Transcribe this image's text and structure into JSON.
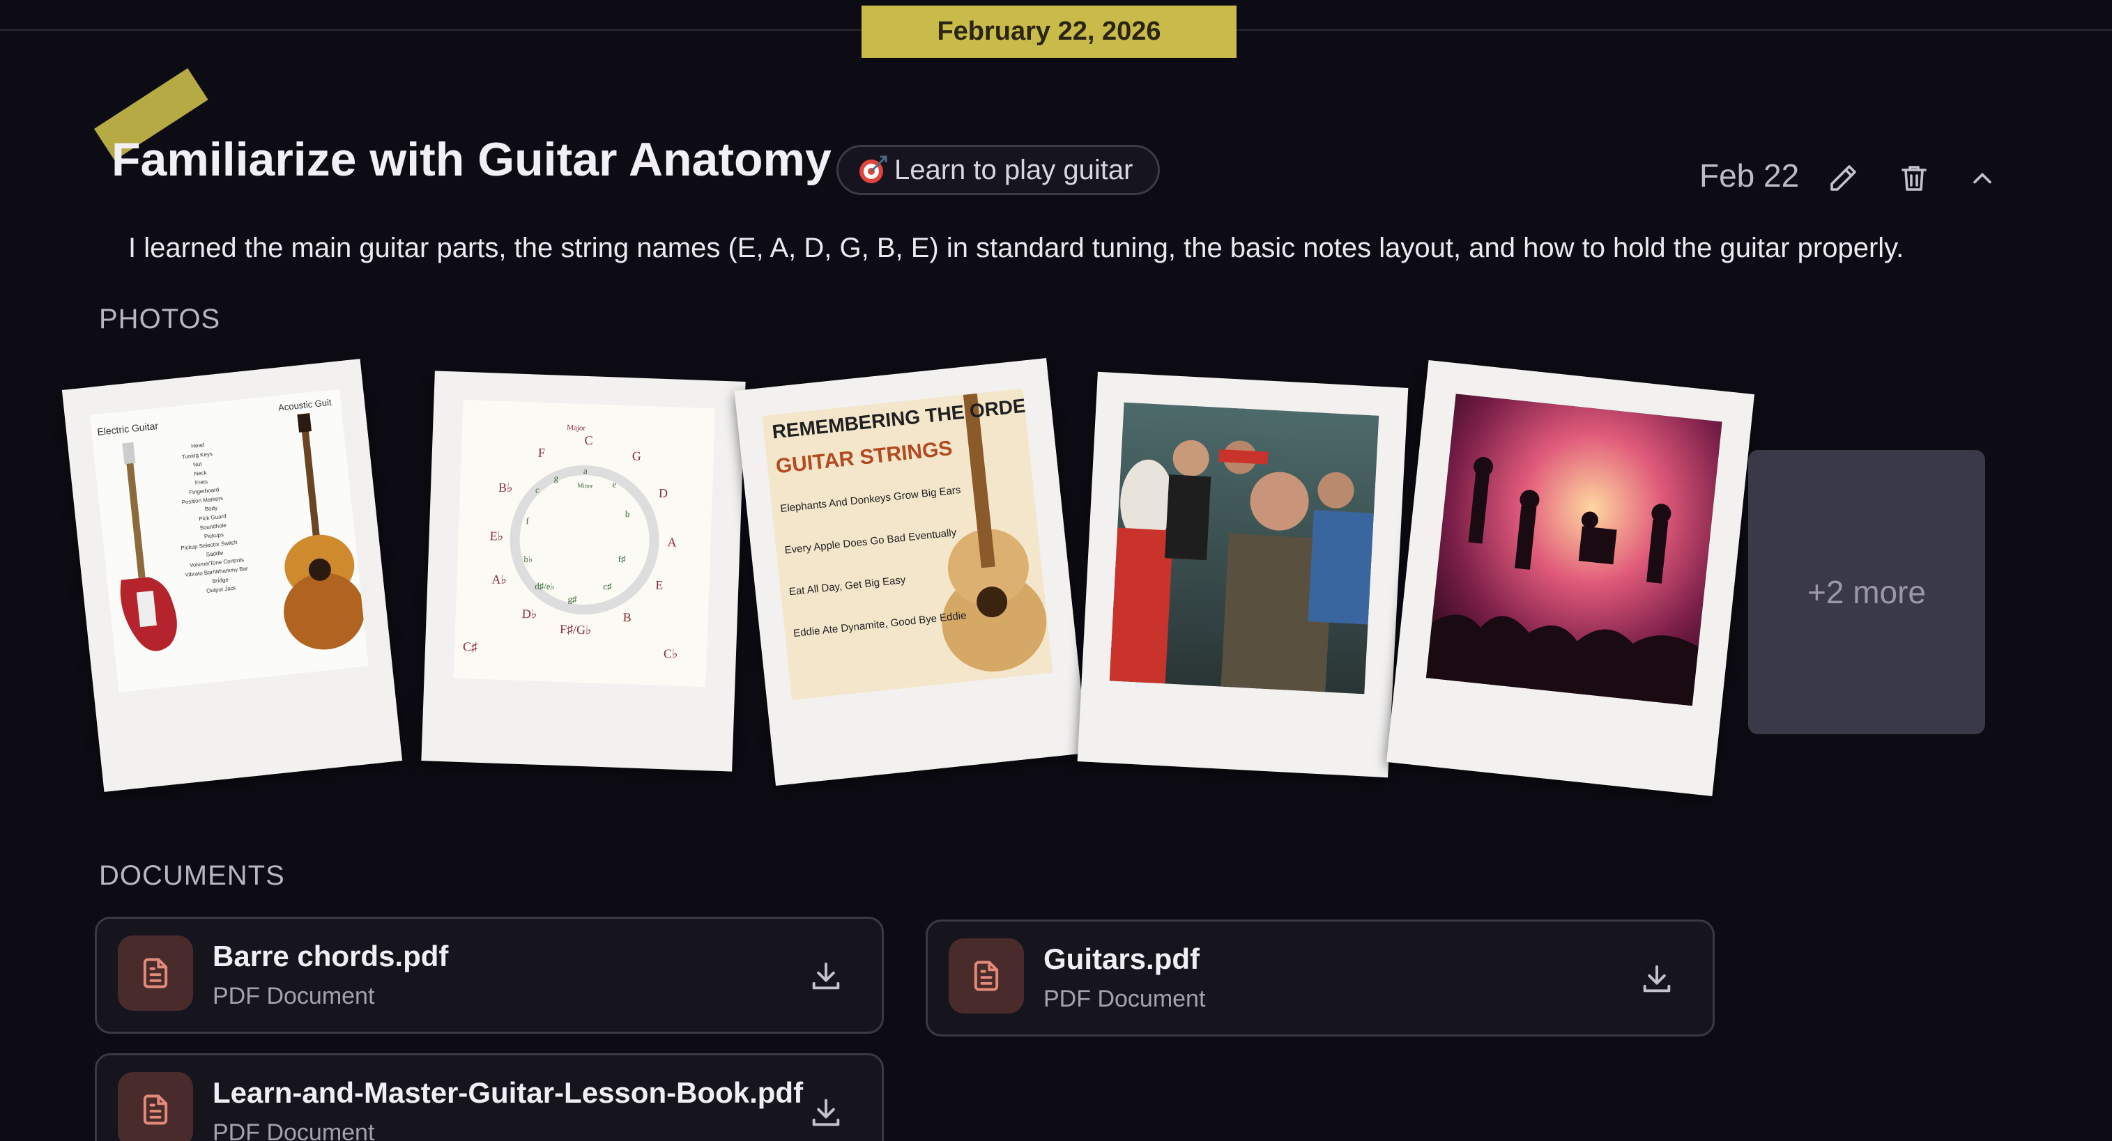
{
  "date_banner": "February 22, 2026",
  "entry": {
    "title": "Familiarize with Guitar Anatomy",
    "goal": "Learn to play guitar",
    "date": "Feb 22",
    "description": "I learned the main guitar parts, the string names (E, A, D, G, B, E) in standard tuning, the basic notes layout, and how to hold the guitar properly."
  },
  "photos": {
    "label": "PHOTOS",
    "items": [
      {
        "subject": "guitar anatomy diagram",
        "text": [
          "Electric Guitar",
          "Acoustic Guit",
          "Head",
          "Tuning Keys",
          "Nut",
          "Neck",
          "Frets",
          "Fingerboard",
          "Position Markers",
          "Body",
          "Pick Guard",
          "Soundhole",
          "Pickups",
          "Pickup Selector Switch",
          "Saddle",
          "Volume/Tone Controls",
          "Vibrato Bar/Whammy Bar",
          "Bridge",
          "Output Jack"
        ]
      },
      {
        "subject": "circle of fifths chart",
        "text": [
          "Major",
          "C",
          "G",
          "D",
          "A",
          "E",
          "B",
          "F♯/G♭",
          "D♭",
          "A♭",
          "E♭",
          "B♭",
          "F",
          "Minor",
          "a",
          "e",
          "b",
          "f♯",
          "c♯",
          "g♯",
          "d♯/e♭",
          "b♭",
          "f",
          "c",
          "g",
          "d",
          "C♯",
          "C♭"
        ]
      },
      {
        "subject": "guitar string order poster",
        "text": [
          "REMEMBERING THE ORDER OF",
          "GUITAR STRINGS",
          "Elephants And Donkeys Grow Big Ears",
          "Every Apple Does Go Bad Eventually",
          "Eat All Day, Get Big Easy",
          "Eddie Ate Dynamite, Good Bye Eddie"
        ]
      },
      {
        "subject": "band group photo"
      },
      {
        "subject": "live concert photo"
      }
    ],
    "more_label": "+2 more"
  },
  "documents": {
    "label": "DOCUMENTS",
    "items": [
      {
        "name": "Barre chords.pdf",
        "type": "PDF Document"
      },
      {
        "name": "Guitars.pdf",
        "type": "PDF Document"
      },
      {
        "name": "Learn-and-Master-Guitar-Lesson-Book.pdf",
        "type": "PDF Document"
      }
    ]
  },
  "colors": {
    "background": "#0d0c14",
    "tape": "#c9bb4a",
    "doc_icon_bg": "#4a2b2c",
    "doc_icon_fg": "#e38b7a"
  }
}
